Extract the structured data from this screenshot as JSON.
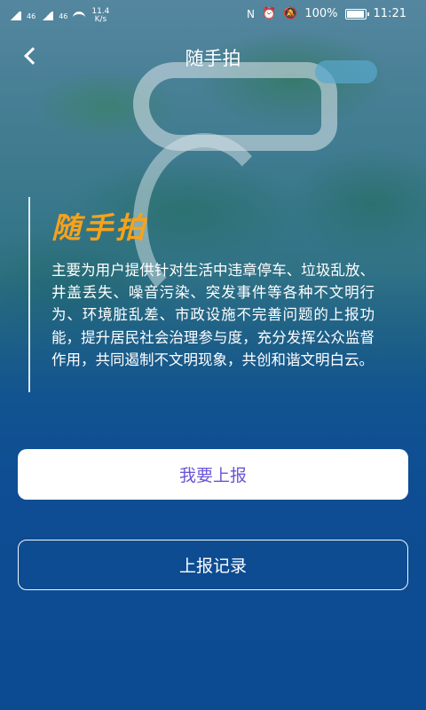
{
  "status_bar": {
    "signal1": "46",
    "signal2": "46",
    "speed": "11.4 K/s",
    "battery": "100%",
    "battery_level": 1.0,
    "time": "11:21"
  },
  "header": {
    "title": "随手拍"
  },
  "intro": {
    "brand": "随手拍",
    "description": "主要为用户提供针对生活中违章停车、垃圾乱放、井盖丢失、噪音污染、突发事件等各种不文明行为、环境脏乱差、市政设施不完善问题的上报功能，提升居民社会治理参与度，充分发挥公众监督作用，共同遏制不文明现象，共创和谐文明白云。"
  },
  "actions": {
    "report_label": "我要上报",
    "records_label": "上报记录"
  },
  "colors": {
    "brand_orange": "#f7a21a",
    "report_text": "#6b55d8",
    "background_blue": "#0e4d93"
  }
}
